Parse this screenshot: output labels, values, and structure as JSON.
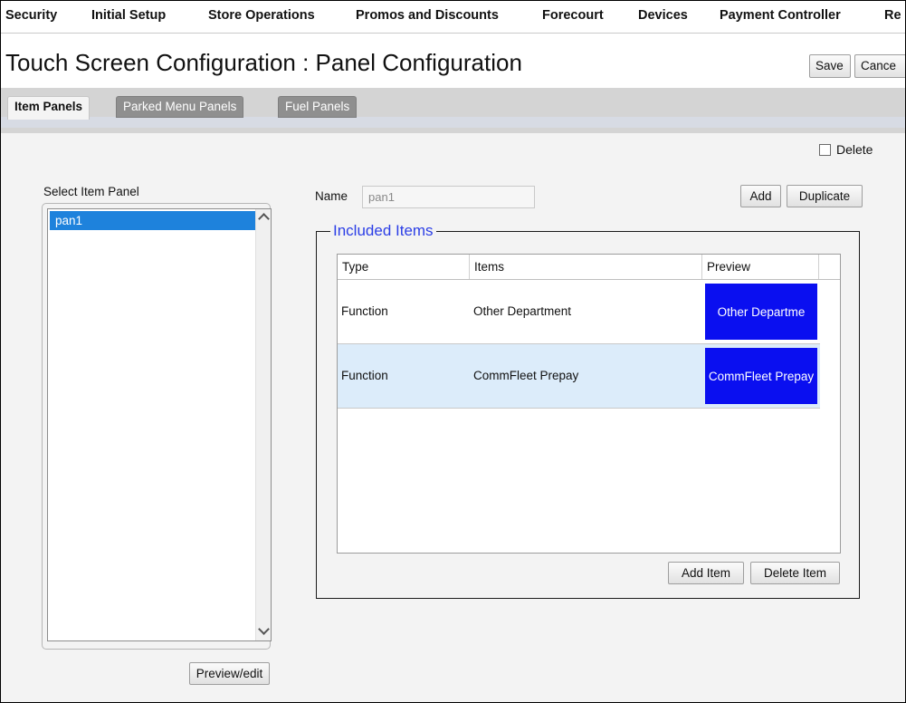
{
  "menu": [
    "Security",
    "Initial Setup",
    "Store Operations",
    "Promos and Discounts",
    "Forecourt",
    "Devices",
    "Payment Controller",
    "Re"
  ],
  "page": {
    "title": "Touch Screen Configuration : Panel Configuration",
    "save_label": "Save",
    "cancel_label": "Cance"
  },
  "tabs": [
    {
      "label": "Item Panels",
      "active": true
    },
    {
      "label": "Parked Menu Panels",
      "active": false
    },
    {
      "label": "Fuel Panels",
      "active": false
    }
  ],
  "delete_label": "Delete",
  "left": {
    "heading": "Select Item Panel",
    "items": [
      "pan1"
    ],
    "preview_label": "Preview/edit"
  },
  "form": {
    "name_label": "Name",
    "name_value": "pan1",
    "add_label": "Add",
    "duplicate_label": "Duplicate"
  },
  "included": {
    "legend": "Included Items",
    "columns": [
      "Type",
      "Items",
      "Preview"
    ],
    "rows": [
      {
        "type": "Function",
        "item": "Other Department",
        "preview": "Other Departme",
        "selected": false
      },
      {
        "type": "Function",
        "item": "CommFleet Prepay",
        "preview": "CommFleet Prepay",
        "selected": true
      }
    ],
    "add_item_label": "Add Item",
    "delete_item_label": "Delete Item"
  },
  "colors": {
    "selection": "#1e82dc",
    "preview_button": "#0a0ff0",
    "legend_text": "#2b3ee6",
    "row_selected": "#dcecfa"
  }
}
